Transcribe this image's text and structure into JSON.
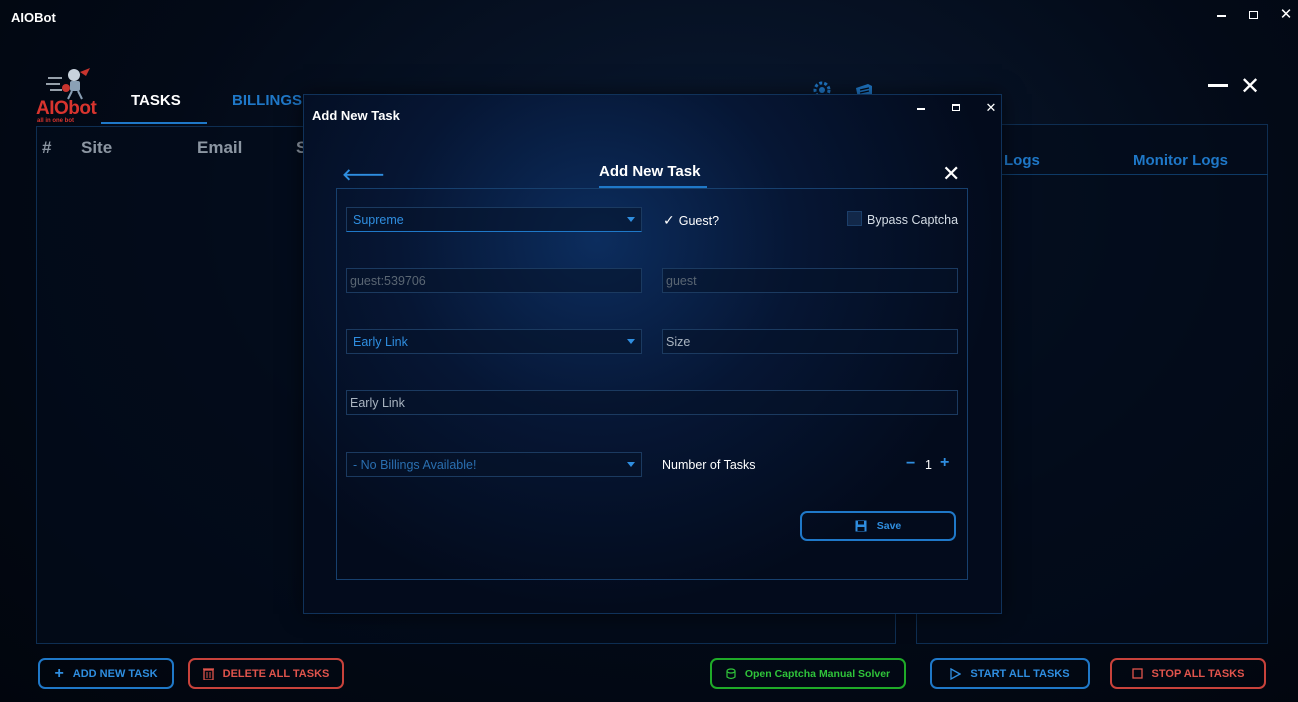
{
  "window": {
    "title": "AIOBot"
  },
  "logo": {
    "text": "AIObot",
    "tagline": "all in one bot"
  },
  "nav": {
    "tasks": "TASKS",
    "billings": "BILLINGS"
  },
  "table": {
    "headers": [
      "#",
      "Site",
      "Email",
      "S"
    ]
  },
  "logs": {
    "tab1": "Logs",
    "tab2": "Monitor Logs"
  },
  "bottom": {
    "add": "ADD NEW TASK",
    "delete": "DELETE ALL TASKS",
    "captcha": "Open Captcha Manual Solver",
    "start": "START ALL TASKS",
    "stop": "STOP ALL TASKS"
  },
  "modal": {
    "window_title": "Add New Task",
    "title": "Add New Task",
    "site": "Supreme",
    "guest_label": "Guest?",
    "guest_checked": true,
    "bypass_label": "Bypass Captcha",
    "bypass_checked": false,
    "username_placeholder": "guest:539706",
    "password_placeholder": "guest",
    "mode": "Early Link",
    "size_placeholder": "Size",
    "link_placeholder": "Early Link",
    "billing": "- No Billings Available!",
    "num_tasks_label": "Number of Tasks",
    "num_tasks_value": "1",
    "save_label": "Save"
  },
  "colors": {
    "accent": "#1f78c8",
    "danger": "#c8423b",
    "success": "#1faa28",
    "background": "#030a17"
  }
}
